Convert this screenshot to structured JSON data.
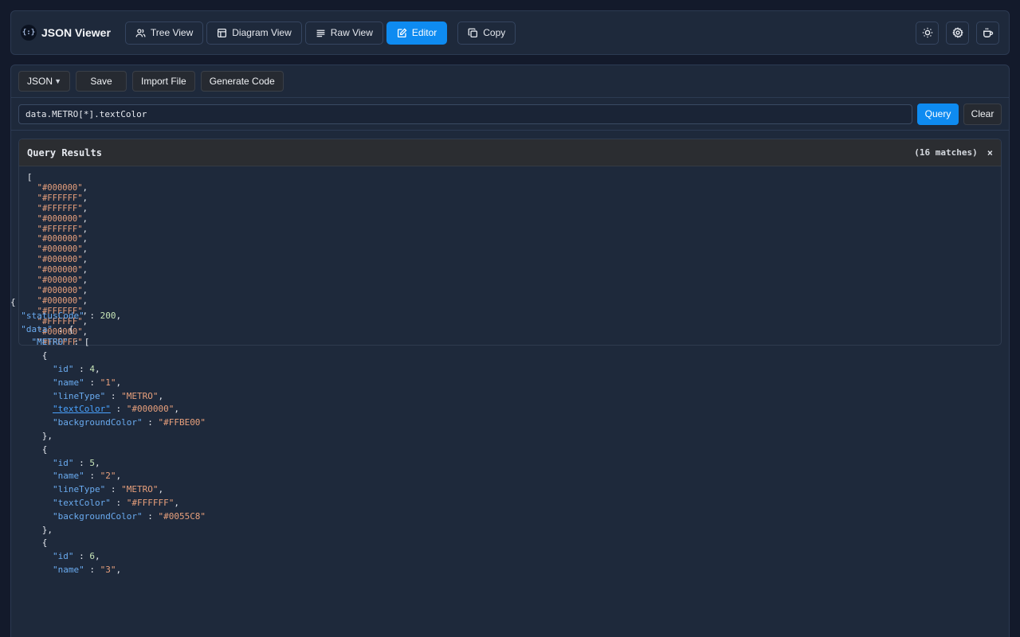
{
  "app": {
    "title": "JSON Viewer",
    "logo_glyph": "{:}"
  },
  "nav": {
    "tree_view": "Tree View",
    "diagram_view": "Diagram View",
    "raw_view": "Raw View",
    "editor": "Editor",
    "copy": "Copy"
  },
  "header_icons": [
    "sun-icon",
    "gear-icon",
    "coffee-icon"
  ],
  "toolbar": {
    "format_select": "JSON",
    "save": "Save",
    "import_file": "Import File",
    "generate_code": "Generate Code"
  },
  "query": {
    "value": "data.METRO[*].textColor",
    "query_btn": "Query",
    "clear_btn": "Clear"
  },
  "results": {
    "title": "Query Results",
    "count": "(16 matches)",
    "close": "×",
    "open_bracket": "[",
    "items": [
      "\"#000000\"",
      "\"#FFFFFF\"",
      "\"#FFFFFF\"",
      "\"#000000\"",
      "\"#FFFFFF\"",
      "\"#000000\"",
      "\"#000000\"",
      "\"#000000\"",
      "\"#000000\"",
      "\"#000000\"",
      "\"#000000\"",
      "\"#000000\"",
      "\"#FFFFFF\"",
      "\"#FFFFFF\"",
      "\"#000000\"",
      "\"#FFFFFF\""
    ]
  },
  "editor": {
    "lines": [
      {
        "indent": 0,
        "text": "{"
      },
      {
        "indent": 1,
        "key": "\"statusCode\"",
        "value": "200",
        "vtype": "num",
        "comma": true
      },
      {
        "indent": 1,
        "key": "\"data\"",
        "value": "{",
        "vtype": "punct"
      },
      {
        "indent": 2,
        "key": "\"METRO\"",
        "value": "[",
        "vtype": "punct"
      },
      {
        "indent": 3,
        "text": "{"
      },
      {
        "indent": 4,
        "key": "\"id\"",
        "value": "4",
        "vtype": "num",
        "comma": true
      },
      {
        "indent": 4,
        "key": "\"name\"",
        "value": "\"1\"",
        "vtype": "str",
        "comma": true
      },
      {
        "indent": 4,
        "key": "\"lineType\"",
        "value": "\"METRO\"",
        "vtype": "str",
        "comma": true
      },
      {
        "indent": 4,
        "key": "\"textColor\"",
        "value": "\"#000000\"",
        "vtype": "str",
        "comma": true,
        "link": true
      },
      {
        "indent": 4,
        "key": "\"backgroundColor\"",
        "value": "\"#FFBE00\"",
        "vtype": "str"
      },
      {
        "indent": 3,
        "text": "},"
      },
      {
        "indent": 3,
        "text": "{"
      },
      {
        "indent": 4,
        "key": "\"id\"",
        "value": "5",
        "vtype": "num",
        "comma": true
      },
      {
        "indent": 4,
        "key": "\"name\"",
        "value": "\"2\"",
        "vtype": "str",
        "comma": true
      },
      {
        "indent": 4,
        "key": "\"lineType\"",
        "value": "\"METRO\"",
        "vtype": "str",
        "comma": true
      },
      {
        "indent": 4,
        "key": "\"textColor\"",
        "value": "\"#FFFFFF\"",
        "vtype": "str",
        "comma": true
      },
      {
        "indent": 4,
        "key": "\"backgroundColor\"",
        "value": "\"#0055C8\"",
        "vtype": "str"
      },
      {
        "indent": 3,
        "text": "},"
      },
      {
        "indent": 3,
        "text": "{"
      },
      {
        "indent": 4,
        "key": "\"id\"",
        "value": "6",
        "vtype": "num",
        "comma": true
      },
      {
        "indent": 4,
        "key": "\"name\"",
        "value": "\"3\"",
        "vtype": "str",
        "comma": true
      }
    ]
  },
  "colors": {
    "accent": "#0e8bf1",
    "key": "#6aabf0",
    "string": "#e8a07c",
    "number": "#c8e6b8"
  }
}
